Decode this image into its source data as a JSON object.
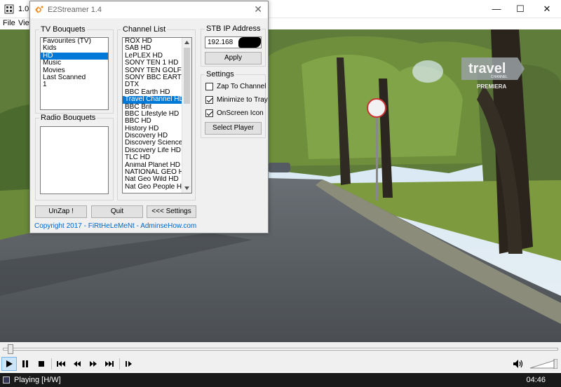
{
  "player": {
    "title": "1.0:1",
    "menu": [
      "File",
      "View"
    ],
    "status_text": "Playing [H/W]",
    "time_text": "04:46",
    "seek_position": 0.01,
    "volume_level": 1.0
  },
  "overlay": {
    "channel_logo": "travel",
    "channel_logo_sub": "CHANNEL",
    "channel_caption": "PREMIERA"
  },
  "dialog": {
    "title": "E2Streamer 1.4",
    "tv_bouquets": {
      "label": "TV Bouquets",
      "items": [
        "Favourites (TV)",
        "Kids",
        "HD",
        "Music",
        "Movies",
        "Last Scanned",
        "1"
      ],
      "selected_index": 2
    },
    "radio_bouquets": {
      "label": "Radio Bouquets",
      "items": []
    },
    "channel_list": {
      "label": "Channel List",
      "items": [
        "ROX HD",
        "SAB HD",
        "LePLEX HD",
        "SONY TEN 1 HD",
        "SONY TEN GOLF HD",
        "SONY BBC EARTH HD",
        "DTX",
        "BBC Earth HD",
        "Travel Channel HD",
        "BBC Brit",
        "BBC Lifestyle HD",
        "BBC HD",
        "History HD",
        "Discovery HD",
        "Discovery Science HD",
        "Discovery Life HD",
        "TLC HD",
        "Animal Planet HD",
        "NATIONAL GEO HD",
        "Nat Geo Wild HD",
        "Nat Geo People HD"
      ],
      "selected_index": 8
    },
    "stb": {
      "label": "STB IP Address",
      "ip_value": "192.168",
      "apply_label": "Apply"
    },
    "settings": {
      "label": "Settings",
      "zap_to_channel": {
        "label": "Zap To Channel",
        "checked": false
      },
      "minimize_to_tray": {
        "label": "Minimize to Tray",
        "checked": true
      },
      "onscreen_icon": {
        "label": "OnScreen Icon",
        "checked": true
      },
      "select_player_label": "Select Player"
    },
    "buttons": {
      "unzap": "UnZap !",
      "quit": "Quit",
      "settings": "<<< Settings"
    },
    "footer": {
      "copyright": "Copyright 2017 - FiRtHeLeMeNt -",
      "site": "AdminseHow.com"
    }
  },
  "icons": [
    "mpc-icon",
    "e2streamer-icon",
    "minimize-icon",
    "maximize-icon",
    "close-icon",
    "play-icon",
    "pause-icon",
    "stop-icon",
    "skip-back-icon",
    "rewind-icon",
    "fast-forward-icon",
    "skip-forward-icon",
    "frame-step-icon",
    "speaker-icon"
  ]
}
